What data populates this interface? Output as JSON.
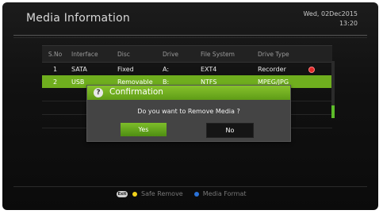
{
  "header": {
    "title": "Media Information",
    "date": "Wed, 02Dec2015",
    "time": "13:20"
  },
  "table": {
    "columns": [
      "S.No",
      "Interface",
      "Disc",
      "Drive",
      "File System",
      "Drive Type"
    ],
    "rows": [
      {
        "sno": "1",
        "interface": "SATA",
        "disc": "Fixed",
        "drive": "A:",
        "fs": "EXT4",
        "type": "Recorder"
      },
      {
        "sno": "2",
        "interface": "USB",
        "disc": "Removable",
        "drive": "B:",
        "fs": "NTFS",
        "type": "MPEG/JPG"
      }
    ],
    "selected_row": 2
  },
  "dialog": {
    "title": "Confirmation",
    "message": "Do you want to Remove Media ?",
    "yes": "Yes",
    "no": "No"
  },
  "footer": {
    "exit_key": "Exit",
    "safe_remove": "Safe Remove",
    "media_format": "Media Format"
  },
  "colors": {
    "accent": "#6fae1e",
    "remove_icon": "#e02828",
    "safe_remove_key": "#f2d21a",
    "media_format_key": "#2a72d8"
  }
}
